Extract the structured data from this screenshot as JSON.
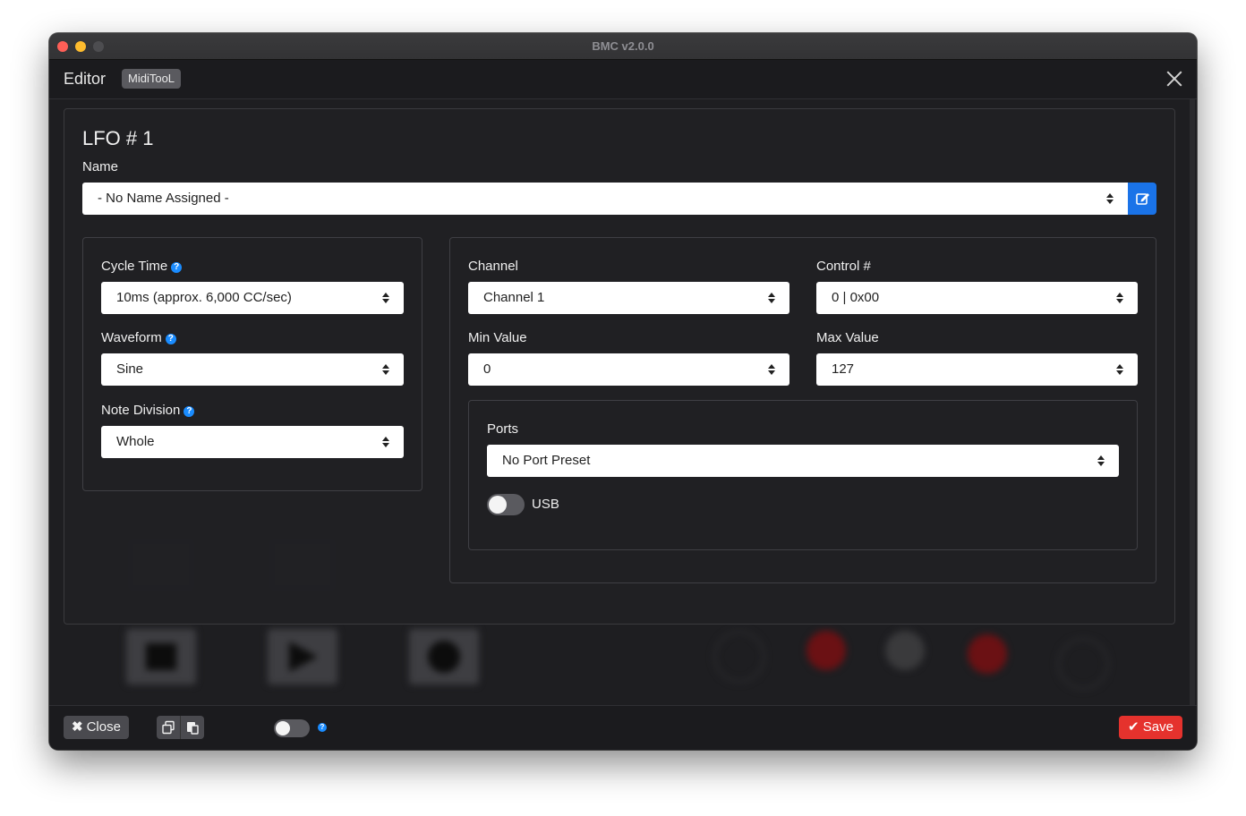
{
  "window": {
    "title": "BMC v2.0.0"
  },
  "modal": {
    "title": "Editor",
    "badge": "MidiTooL",
    "close_icon": "close-icon"
  },
  "lfo": {
    "heading": "LFO # 1",
    "name_label": "Name",
    "name_value": "- No Name Assigned -",
    "edit_icon": "edit-icon",
    "left_panel": {
      "cycle_time": {
        "label": "Cycle Time",
        "value": "10ms (approx. 6,000 CC/sec)",
        "help": "?"
      },
      "waveform": {
        "label": "Waveform",
        "value": "Sine",
        "help": "?"
      },
      "note_division": {
        "label": "Note Division",
        "value": "Whole",
        "help": "?"
      }
    },
    "right_panel": {
      "channel": {
        "label": "Channel",
        "value": "Channel 1"
      },
      "control": {
        "label": "Control #",
        "value": "0 | 0x00"
      },
      "min_value": {
        "label": "Min Value",
        "value": "0"
      },
      "max_value": {
        "label": "Max Value",
        "value": "127"
      },
      "ports": {
        "label": "Ports",
        "value": "No Port Preset",
        "usb_label": "USB",
        "usb_enabled": false
      }
    }
  },
  "footer": {
    "close_label": "Close",
    "copy_icon": "copy-icon",
    "paste_icon": "paste-icon",
    "toggle_enabled": false,
    "help": "?",
    "save_label": "Save"
  },
  "colors": {
    "accent": "#1a73e8",
    "help": "#1a8cff",
    "save": "#e5322d",
    "background": "#1c1c1f"
  }
}
